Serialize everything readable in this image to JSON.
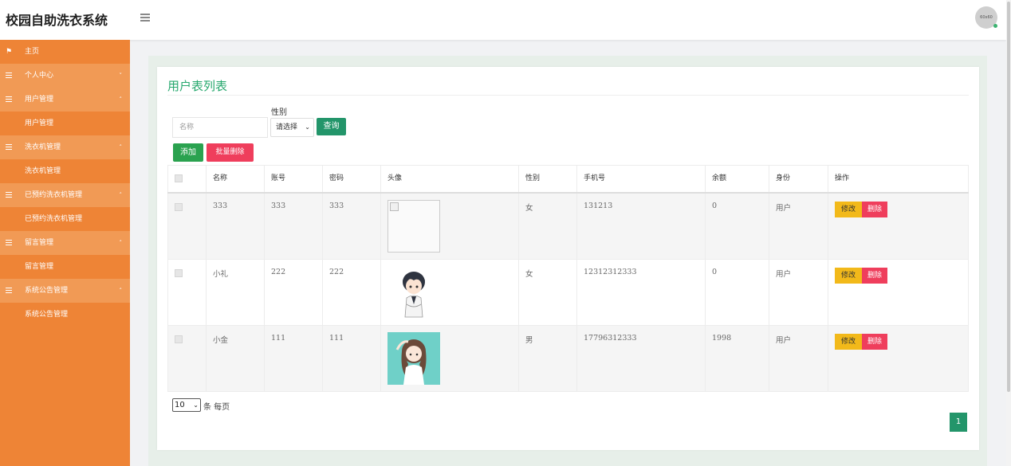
{
  "app": {
    "title": "校园自助洗衣系统",
    "avatar_text": "60x60"
  },
  "sidebar": {
    "items": [
      {
        "label": "主页",
        "icon": "flag-icon"
      },
      {
        "label": "个人中心",
        "icon": "grid-icon",
        "arrow": "˅"
      },
      {
        "label": "用户管理",
        "icon": "grid-icon",
        "arrow": "˄"
      },
      {
        "label": "用户管理",
        "child": true
      },
      {
        "label": "洗衣机管理",
        "icon": "grid-icon",
        "arrow": "˄"
      },
      {
        "label": "洗衣机管理",
        "child": true
      },
      {
        "label": "已预约洗衣机管理",
        "icon": "grid-icon",
        "arrow": "˄"
      },
      {
        "label": "已预约洗衣机管理",
        "child": true
      },
      {
        "label": "留言管理",
        "icon": "grid-icon",
        "arrow": "˄"
      },
      {
        "label": "留言管理",
        "child": true
      },
      {
        "label": "系统公告管理",
        "icon": "grid-icon",
        "arrow": "˄"
      },
      {
        "label": "系统公告管理",
        "child": true
      }
    ]
  },
  "main": {
    "title": "用户表列表",
    "search": {
      "name_placeholder": "名称",
      "sex_label": "性别",
      "sex_value": "请选择",
      "query_label": "查询"
    },
    "actions": {
      "add_label": "添加",
      "batch_delete_label": "批量删除"
    },
    "table": {
      "headers": [
        "名称",
        "账号",
        "密码",
        "头像",
        "性别",
        "手机号",
        "余额",
        "身份",
        "操作"
      ],
      "rows": [
        {
          "name": "333",
          "account": "333",
          "password": "333",
          "avatar": "broken",
          "sex": "女",
          "phone": "131213",
          "balance": "0",
          "role": "用户"
        },
        {
          "name": "小礼",
          "account": "222",
          "password": "222",
          "avatar": "boy",
          "sex": "女",
          "phone": "12312312333",
          "balance": "0",
          "role": "用户"
        },
        {
          "name": "小金",
          "account": "111",
          "password": "111",
          "avatar": "girl",
          "sex": "男",
          "phone": "17796312333",
          "balance": "1998",
          "role": "用户"
        }
      ],
      "edit_label": "修改",
      "delete_label": "删除"
    },
    "pagination": {
      "page_size": "10",
      "per_page_label": "条 每页",
      "current_page": "1"
    }
  },
  "colors": {
    "sidebar": "#ee8436",
    "sidebar_parent": "#f19a55",
    "accent_green": "#23956a",
    "danger": "#ef3e5c",
    "warning": "#f2b91a"
  }
}
